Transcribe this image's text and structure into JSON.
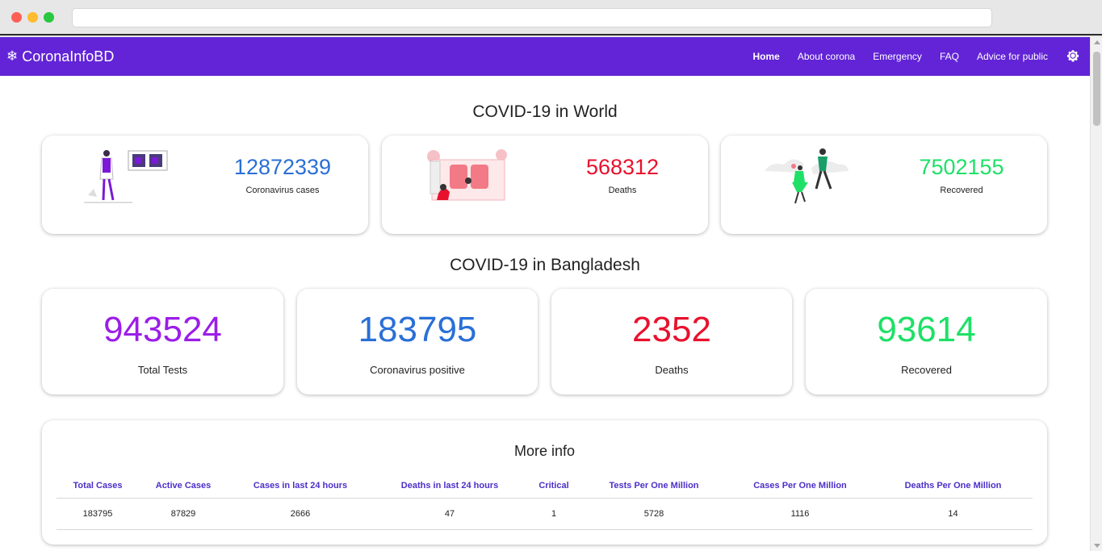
{
  "navbar": {
    "brand": "CoronaInfoBD",
    "links": [
      "Home",
      "About corona",
      "Emergency",
      "FAQ",
      "Advice for public"
    ],
    "brand_color": "#6224d6"
  },
  "world": {
    "title": "COVID-19 in World",
    "cases": {
      "value": "12872339",
      "label": "Coronavirus cases",
      "color": "#2a6fd6"
    },
    "deaths": {
      "value": "568312",
      "label": "Deaths",
      "color": "#e8112d"
    },
    "recovered": {
      "value": "7502155",
      "label": "Recovered",
      "color": "#1ee067"
    }
  },
  "bangladesh": {
    "title": "COVID-19 in Bangladesh",
    "tests": {
      "value": "943524",
      "label": "Total Tests",
      "color": "#9b1ee8"
    },
    "positive": {
      "value": "183795",
      "label": "Coronavirus positive",
      "color": "#2a6fd6"
    },
    "deaths": {
      "value": "2352",
      "label": "Deaths",
      "color": "#e8112d"
    },
    "recovered": {
      "value": "93614",
      "label": "Recovered",
      "color": "#1ee067"
    }
  },
  "more_info": {
    "title": "More info",
    "headers": [
      "Total Cases",
      "Active Cases",
      "Cases in last 24 hours",
      "Deaths in last 24 hours",
      "Critical",
      "Tests Per One Million",
      "Cases Per One Million",
      "Deaths Per One Million"
    ],
    "row": [
      "183795",
      "87829",
      "2666",
      "47",
      "1",
      "5728",
      "1116",
      "14"
    ]
  },
  "icons": {
    "brand": "virus-icon",
    "settings": "gear-icon"
  }
}
